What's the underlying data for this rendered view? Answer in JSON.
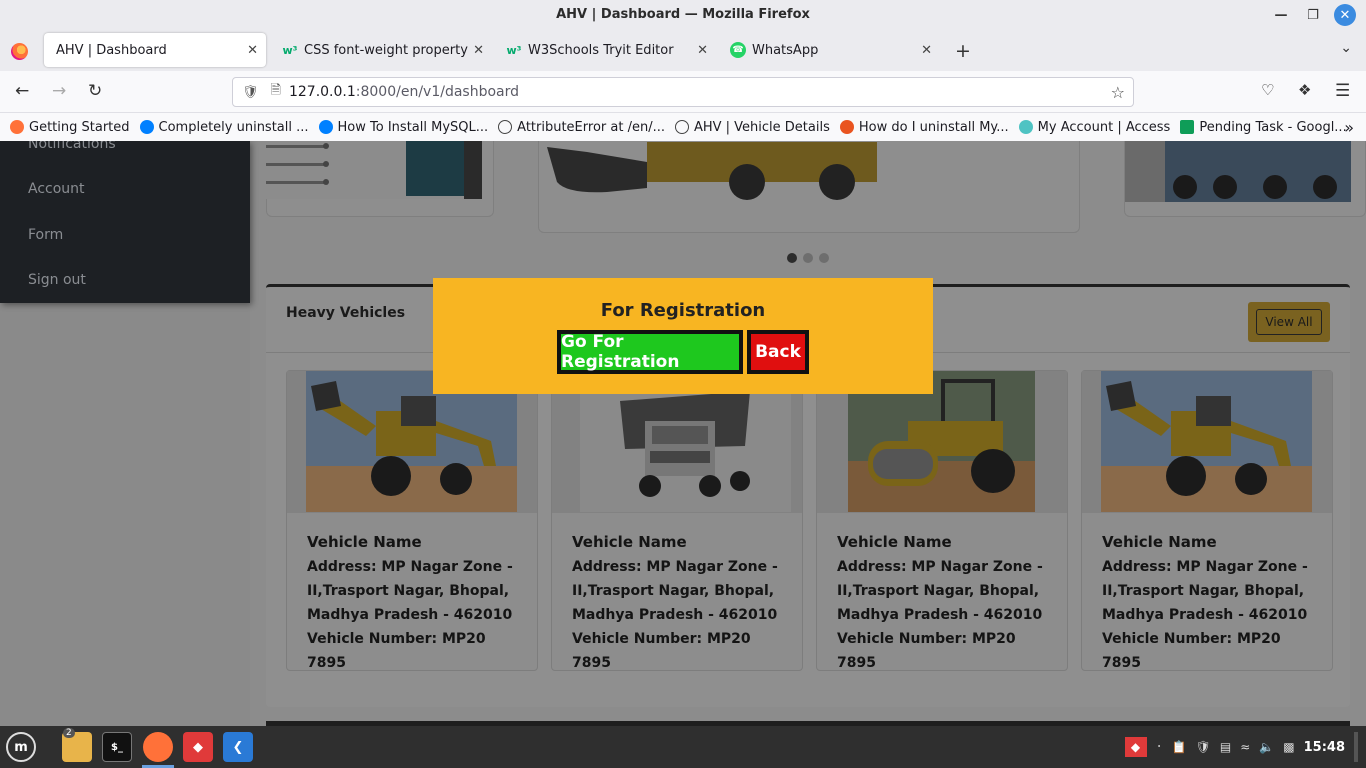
{
  "window": {
    "title": "AHV | Dashboard — Mozilla Firefox"
  },
  "tabs": [
    {
      "label": "AHV | Dashboard",
      "active": true
    },
    {
      "label": "CSS font-weight property",
      "icon": "w3schools-icon"
    },
    {
      "label": "W3Schools Tryit Editor",
      "icon": "w3schools-icon"
    },
    {
      "label": "WhatsApp",
      "icon": "whatsapp-icon"
    }
  ],
  "url": {
    "host": "127.0.0.1",
    "path": ":8000/en/v1/dashboard"
  },
  "bookmarks": [
    {
      "label": "Getting Started",
      "color": "#ff7139"
    },
    {
      "label": "Completely uninstall ...",
      "color": "#0080ff"
    },
    {
      "label": "How To Install MySQL...",
      "color": "#0080ff"
    },
    {
      "label": "AttributeError at /en/...",
      "color": "#666666"
    },
    {
      "label": "AHV | Vehicle Details",
      "color": "#666666"
    },
    {
      "label": "How do I uninstall My...",
      "color": "#e95420"
    },
    {
      "label": "My Account | Access",
      "color": "#4fc3c3"
    },
    {
      "label": "Pending Task - Googl...",
      "color": "#0f9d58"
    }
  ],
  "sidebar": {
    "items": [
      {
        "label": "Notifications"
      },
      {
        "label": "Account"
      },
      {
        "label": "Form"
      },
      {
        "label": "Sign out"
      }
    ]
  },
  "panel": {
    "title": "Heavy Vehicles",
    "view_all": "View All"
  },
  "vehicles": [
    {
      "name": "Vehicle Name",
      "address": "Address: MP Nagar Zone - II,Trasport Nagar, Bhopal, Madhya Pradesh - 462010",
      "number": "Vehicle Number: MP20 7895",
      "image": "backhoe-loader"
    },
    {
      "name": "Vehicle Name",
      "address": "Address: MP Nagar Zone - II,Trasport Nagar, Bhopal, Madhya Pradesh - 462010",
      "number": "Vehicle Number: MP20 7895",
      "image": "dump-truck"
    },
    {
      "name": "Vehicle Name",
      "address": "Address: MP Nagar Zone - II,Trasport Nagar, Bhopal, Madhya Pradesh - 462010",
      "number": "Vehicle Number: MP20 7895",
      "image": "road-roller"
    },
    {
      "name": "Vehicle Name",
      "address": "Address: MP Nagar Zone - II,Trasport Nagar, Bhopal, Madhya Pradesh - 462010",
      "number": "Vehicle Number: MP20 7895",
      "image": "backhoe-loader"
    }
  ],
  "modal": {
    "title": "For Registration",
    "go_label": "Go For Registration",
    "back_label": "Back"
  },
  "taskbar": {
    "files_badge": "2",
    "clock": "15:48"
  },
  "colors": {
    "modal_bg": "#f8b522",
    "go_button": "#1ec81e",
    "back_button": "#e00f0f",
    "sidebar_bg": "#1d2024"
  }
}
